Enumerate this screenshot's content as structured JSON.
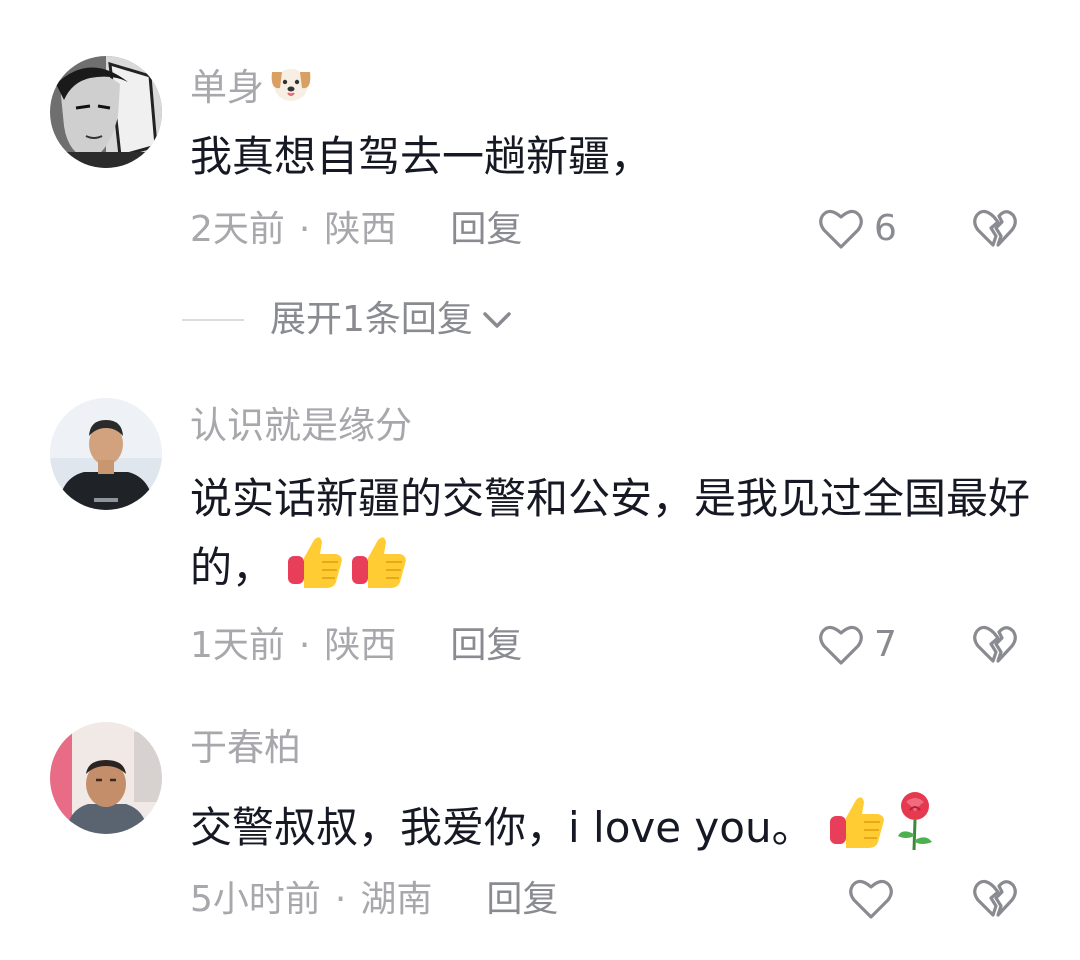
{
  "comments": [
    {
      "username": "单身",
      "text": "我真想自驾去一趟新疆，",
      "time": "2天前",
      "location": "陕西",
      "reply_label": "回复",
      "like_count": "6",
      "name_emoji": "dog-face-emoji"
    },
    {
      "username": "认识就是缘分",
      "text": "说实话新疆的交警和公安，是我见过全国最好的，",
      "time": "1天前",
      "location": "陕西",
      "reply_label": "回复",
      "like_count": "7",
      "emojis": [
        "thumbs-up-emoji",
        "thumbs-up-emoji"
      ]
    },
    {
      "username": "于春柏",
      "text": "交警叔叔，我爱你，i love you。",
      "time": "5小时前",
      "location": "湖南",
      "reply_label": "回复",
      "like_count": "",
      "emojis": [
        "thumbs-up-emoji",
        "rose-emoji"
      ]
    }
  ],
  "expand_replies": {
    "label": "展开1条回复"
  },
  "icons": {
    "like": "heart-outline-icon",
    "dislike": "broken-heart-icon",
    "expand": "chevron-down-icon"
  },
  "colors": {
    "primary_text": "#161823",
    "secondary_text": "#a7a7ac",
    "action_text": "#8a8b91"
  }
}
